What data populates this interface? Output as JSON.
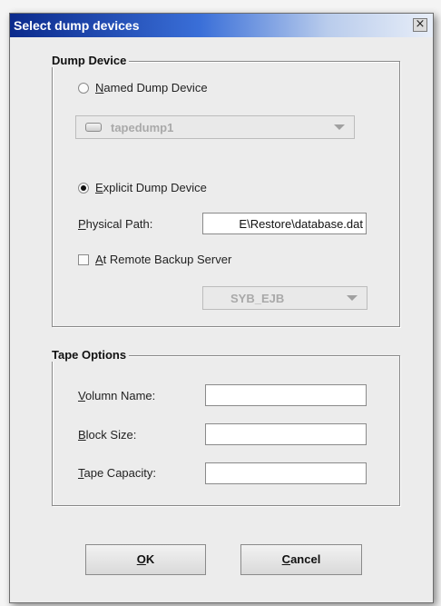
{
  "window": {
    "title": "Select dump devices",
    "close_glyph": "×"
  },
  "dump_device": {
    "legend": "Dump Device",
    "named": {
      "mnemonic": "N",
      "label_rest": "amed Dump Device",
      "selected": false
    },
    "named_combo": {
      "value": "tapedump1",
      "icon": "tape-device-icon",
      "enabled": false
    },
    "explicit": {
      "mnemonic": "E",
      "label_rest": "xplicit Dump Device",
      "selected": true
    },
    "physical_path": {
      "mnemonic": "P",
      "label_rest": "hysical Path:",
      "value": "E\\Restore\\database.dat"
    },
    "remote": {
      "mnemonic": "A",
      "label_rest": "t Remote Backup Server",
      "checked": false
    },
    "remote_combo": {
      "value": "SYB_EJB",
      "enabled": false
    }
  },
  "tape_options": {
    "legend": "Tape Options",
    "volume_name": {
      "mnemonic": "V",
      "label_rest": "olumn Name:",
      "value": ""
    },
    "block_size": {
      "mnemonic": "B",
      "label_rest": "lock Size:",
      "value": ""
    },
    "tape_capacity": {
      "mnemonic": "T",
      "label_rest": "ape Capacity:",
      "value": ""
    }
  },
  "buttons": {
    "ok": {
      "mnemonic": "O",
      "label_rest": "K"
    },
    "cancel": {
      "mnemonic": "C",
      "label_rest": "ancel"
    }
  }
}
